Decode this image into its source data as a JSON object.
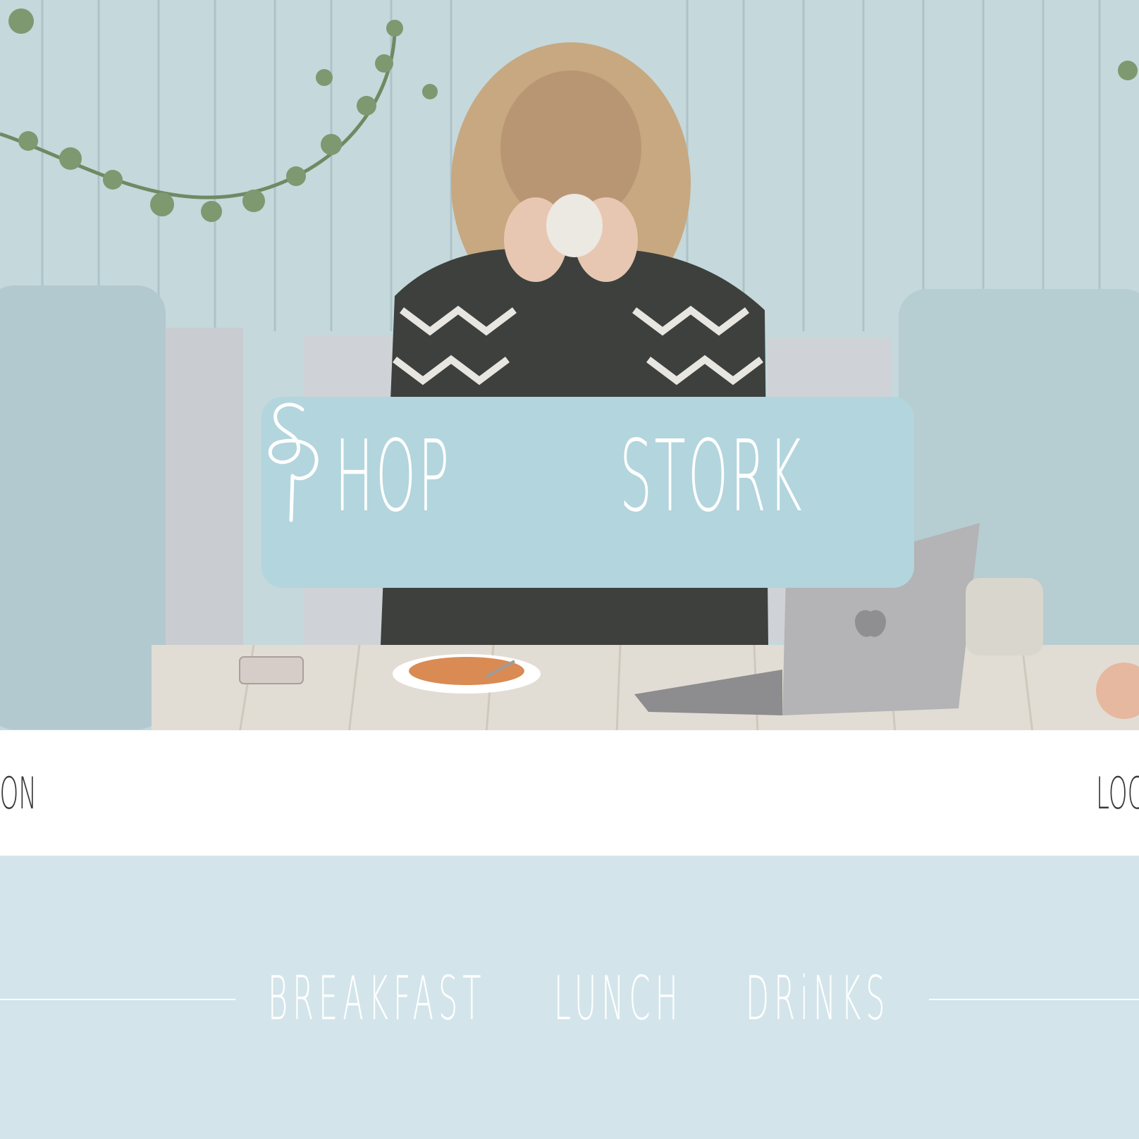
{
  "hero": {
    "photo_description_icon": "photo-icon",
    "logo": {
      "word_left": "HOP",
      "word_right": "STORK",
      "mark_icon": "stork-icon",
      "box_color": "#b3d5dd"
    }
  },
  "nav": {
    "left_link": "iON",
    "right_link": "LOC"
  },
  "band": {
    "background_color": "#d3e5ea",
    "menu": [
      "BREAKFAST",
      "LUNCH",
      "DRiNKS"
    ]
  }
}
